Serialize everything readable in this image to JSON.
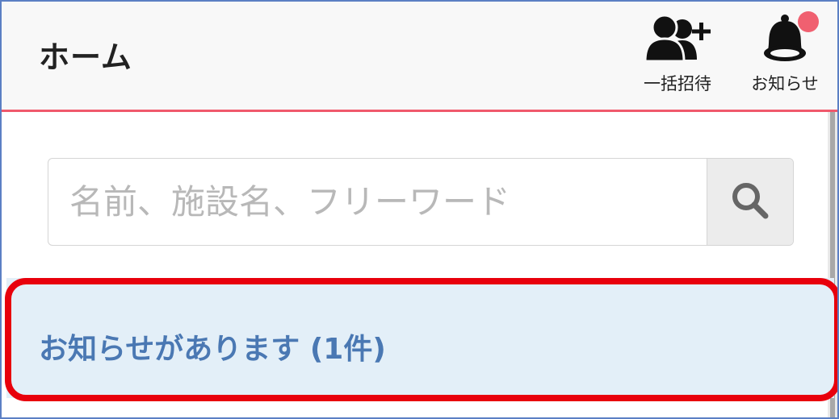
{
  "header": {
    "title": "ホーム",
    "invite_label": "一括招待",
    "notifications_label": "お知らせ",
    "invite_icon": "add-users-icon",
    "notifications_icon": "bell-icon",
    "has_unread_badge": true
  },
  "search": {
    "placeholder": "名前、施設名、フリーワード",
    "value": "",
    "button_icon": "search-icon"
  },
  "notice": {
    "text": "お知らせがあります (1件)"
  },
  "colors": {
    "header_accent": "#f0596c",
    "badge": "#f06070",
    "notice_bg": "#e3eff8",
    "notice_text": "#4a78b3",
    "highlight": "#e8000c"
  }
}
